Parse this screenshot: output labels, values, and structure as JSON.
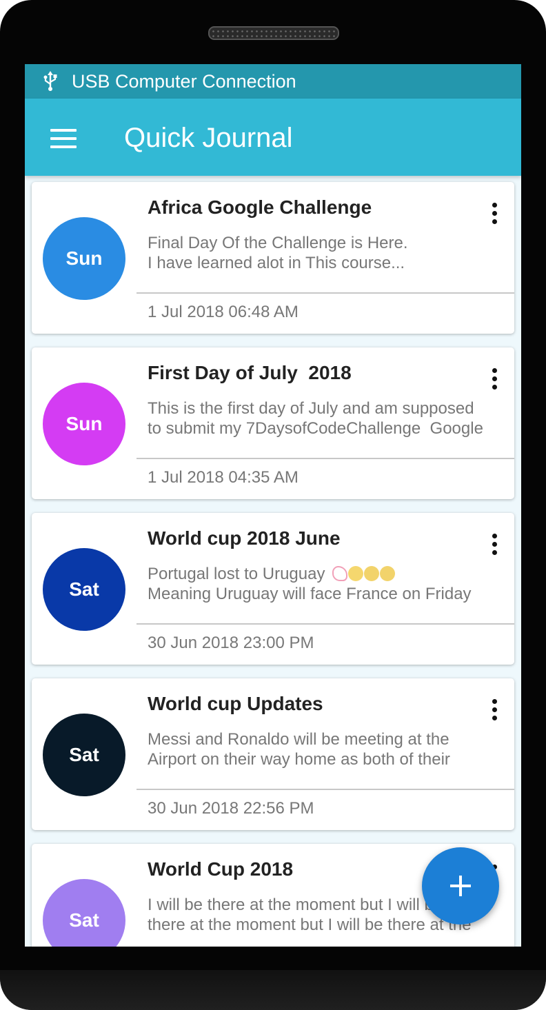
{
  "status_bar": {
    "notification_icon": "usb-icon",
    "notification_text": "USB Computer Connection"
  },
  "app_bar": {
    "menu_icon": "hamburger-menu-icon",
    "title": "Quick Journal"
  },
  "entries": [
    {
      "day": "Sun",
      "avatar_color": "#2a8ce3",
      "title": "Africa Google Challenge",
      "body_line1": "Final Day Of the Challenge is Here.",
      "body_line2": "I have learned alot in This course...",
      "date": "1 Jul 2018 06:48 AM"
    },
    {
      "day": "Sun",
      "avatar_color": "#d43cf3",
      "title": "First Day of July  2018",
      "body_line1": "This is the first day of July and am supposed",
      "body_line2": "to submit my 7DaysofCodeChallenge  Google",
      "date": "1 Jul 2018 04:35 AM"
    },
    {
      "day": "Sat",
      "avatar_color": "#0939a8",
      "title": "World cup 2018 June",
      "body_line1": "Portugal lost to Uruguay",
      "body_line1_emoji": [
        "flexed-biceps-emoji",
        "squinting-tongue-emoji",
        "grinning-face-emoji",
        "grinning-face-emoji"
      ],
      "body_line2": "Meaning Uruguay will face France on Friday",
      "date": "30 Jun 2018 23:00 PM"
    },
    {
      "day": "Sat",
      "avatar_color": "#081a29",
      "title": "World cup Updates",
      "body_line1": "Messi and Ronaldo will be meeting at the",
      "body_line2": "Airport on their way home as both of their",
      "date": "30 Jun 2018 22:56 PM"
    },
    {
      "day": "Sat",
      "avatar_color": "#a07ef0",
      "title": "World Cup 2018",
      "body_line1": "I will be there at the moment but I will be",
      "body_line2": "there at the moment but I will be there at the",
      "date": ""
    }
  ],
  "more_options_icon": "more-vert-icon",
  "fab": {
    "icon": "plus-icon"
  }
}
